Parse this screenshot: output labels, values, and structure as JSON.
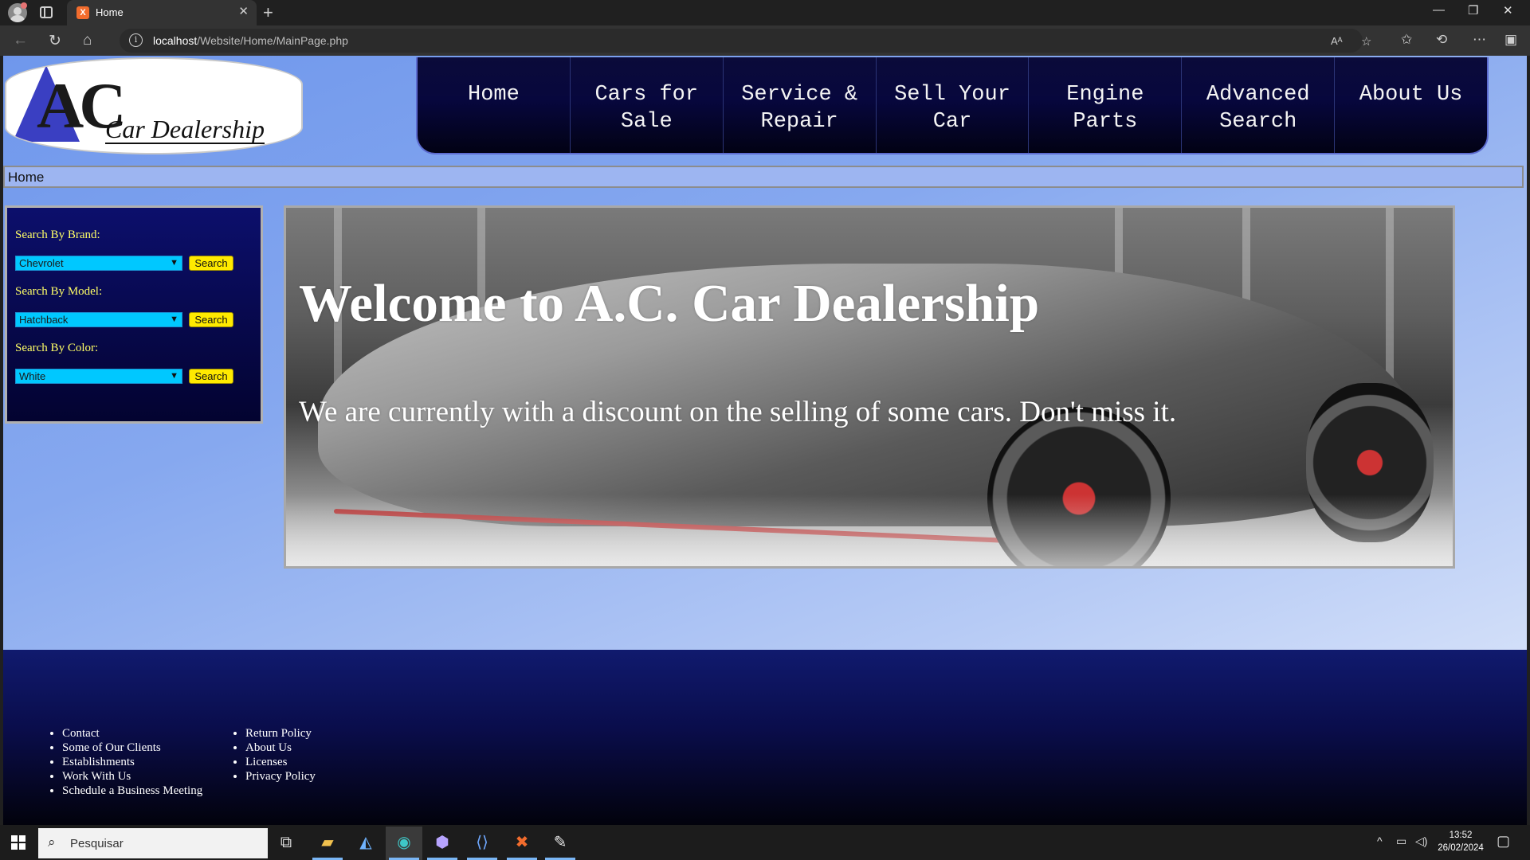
{
  "browser": {
    "tab_title": "Home",
    "tab_favicon": "X",
    "url_host": "localhost",
    "url_path": "/Website/Home/MainPage.php",
    "read_aloud_label": "Aᴬ",
    "colors": {
      "chrome": "#202020",
      "toolbar": "#333333",
      "accent": "#7ab6f5"
    }
  },
  "site": {
    "logo_letters": "AC",
    "logo_text": "Car Dealership",
    "nav": [
      {
        "label": "Home"
      },
      {
        "label": "Cars for Sale"
      },
      {
        "label": "Service & Repair"
      },
      {
        "label": "Sell Your Car"
      },
      {
        "label": "Engine Parts"
      },
      {
        "label": "Advanced Search"
      },
      {
        "label": "About Us"
      }
    ],
    "breadcrumb": "Home",
    "search_panel": {
      "brand_label": "Search By Brand:",
      "brand_value": "Chevrolet",
      "model_label": "Search By Model:",
      "model_value": "Hatchback",
      "color_label": "Search By Color:",
      "color_value": "White",
      "button_label": "Search"
    },
    "hero": {
      "title": "Welcome to A.C. Car Dealership",
      "subtitle": "We are currently with a discount on the selling of some cars. Don't miss it."
    },
    "footer": {
      "col1": [
        "Contact",
        "Some of Our Clients",
        "Establishments",
        "Work With Us",
        "Schedule a Business Meeting"
      ],
      "col2": [
        "Return Policy",
        "About Us",
        "Licenses",
        "Privacy Policy"
      ]
    },
    "colors": {
      "nav_bg": "#07073d",
      "select_bg": "#00c8ff",
      "button_bg": "#ffea00",
      "label_text": "#ffff66"
    }
  },
  "taskbar": {
    "search_placeholder": "Pesquisar",
    "time": "13:52",
    "date": "26/02/2024",
    "apps": [
      "task-view-icon",
      "file-explorer-icon",
      "app-icon",
      "edge-browser-icon",
      "dev-tool-icon",
      "code-editor-icon",
      "xampp-icon",
      "paint-icon"
    ]
  }
}
